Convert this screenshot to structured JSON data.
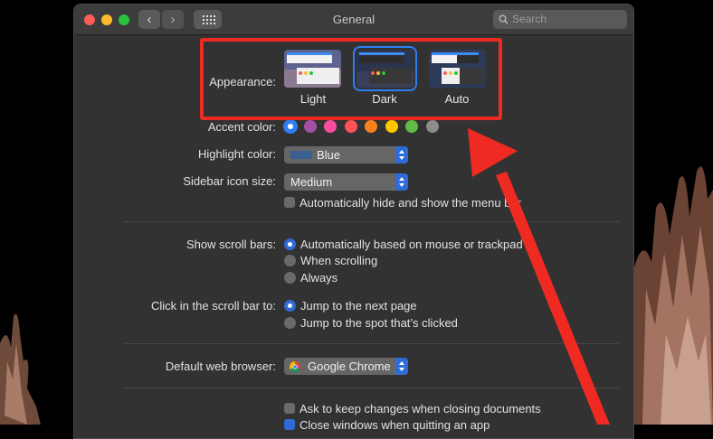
{
  "window": {
    "title": "General"
  },
  "toolbar": {
    "back_glyph": "‹",
    "forward_glyph": "›"
  },
  "search": {
    "placeholder": "Search"
  },
  "appearance": {
    "label": "Appearance:",
    "options": [
      {
        "label": "Light",
        "selected": false
      },
      {
        "label": "Dark",
        "selected": true
      },
      {
        "label": "Auto",
        "selected": false
      }
    ]
  },
  "accent": {
    "label": "Accent color:",
    "colors": [
      "#2f7df6",
      "#a550a7",
      "#f74f9e",
      "#ff5257",
      "#f7821b",
      "#ffc600",
      "#62ba46",
      "#8c8c8c"
    ],
    "selected_index": 0
  },
  "highlight": {
    "label": "Highlight color:",
    "value": "Blue",
    "swatch": "#3a5f93"
  },
  "sidebar_size": {
    "label": "Sidebar icon size:",
    "value": "Medium"
  },
  "menu_bar": {
    "label": "Automatically hide and show the menu bar",
    "checked": false
  },
  "scroll_bars": {
    "label": "Show scroll bars:",
    "options": [
      "Automatically based on mouse or trackpad",
      "When scrolling",
      "Always"
    ],
    "selected_index": 0
  },
  "scroll_click": {
    "label": "Click in the scroll bar to:",
    "options": [
      "Jump to the next page",
      "Jump to the spot that’s clicked"
    ],
    "selected_index": 0
  },
  "browser": {
    "label": "Default web browser:",
    "value": "Google Chrome"
  },
  "documents": {
    "ask_keep": {
      "label": "Ask to keep changes when closing documents",
      "checked": false
    },
    "close_windows": {
      "label": "Close windows when quitting an app",
      "checked": true
    }
  },
  "colors": {
    "highlight_box": "#ef2a22",
    "arrow": "#ef2a22",
    "selection": "#2f6bd6"
  }
}
